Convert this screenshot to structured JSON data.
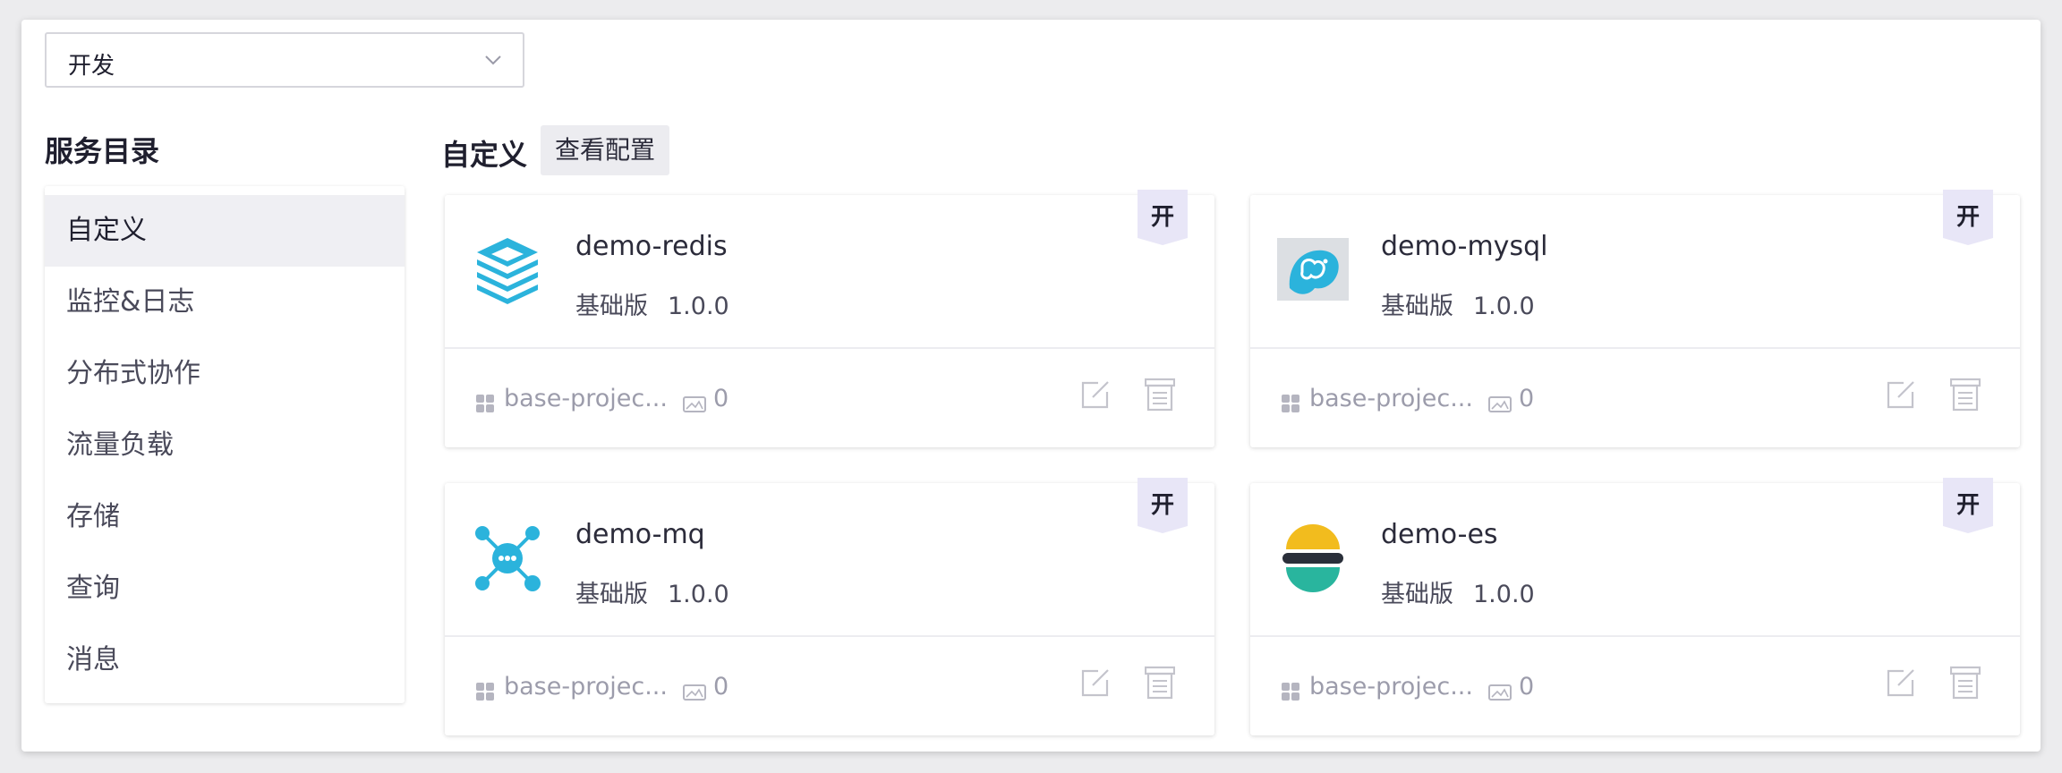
{
  "environment": {
    "selected": "开发"
  },
  "catalog": {
    "title": "服务目录",
    "items": [
      {
        "label": "自定义",
        "active": true
      },
      {
        "label": "监控&日志"
      },
      {
        "label": "分布式协作"
      },
      {
        "label": "流量负载"
      },
      {
        "label": "存储"
      },
      {
        "label": "查询"
      },
      {
        "label": "消息"
      }
    ]
  },
  "section": {
    "title": "自定义",
    "config_button": "查看配置"
  },
  "cards": [
    {
      "name": "demo-redis",
      "edition": "基础版",
      "version": "1.0.0",
      "project": "base-projec...",
      "count": "0",
      "badge": "开",
      "icon": "redis-stack-icon"
    },
    {
      "name": "demo-mysql",
      "edition": "基础版",
      "version": "1.0.0",
      "project": "base-projec...",
      "count": "0",
      "badge": "开",
      "icon": "mysql-dolphin-icon"
    },
    {
      "name": "demo-mq",
      "edition": "基础版",
      "version": "1.0.0",
      "project": "base-projec...",
      "count": "0",
      "badge": "开",
      "icon": "message-queue-icon"
    },
    {
      "name": "demo-es",
      "edition": "基础版",
      "version": "1.0.0",
      "project": "base-projec...",
      "count": "0",
      "badge": "开",
      "icon": "elasticsearch-icon"
    }
  ],
  "colors": {
    "accent_cyan": "#2bb3dc",
    "badge_bg": "#e8e6f7",
    "es_yellow": "#f2bc1e",
    "es_dark": "#2a2f3a",
    "es_teal": "#29b59e"
  }
}
